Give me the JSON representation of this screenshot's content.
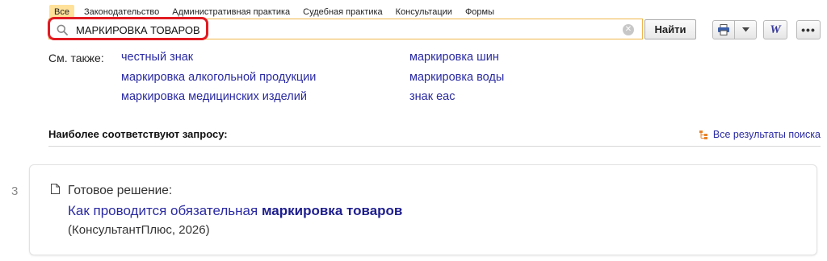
{
  "tabs": [
    "Все",
    "Законодательство",
    "Административная практика",
    "Судебная практика",
    "Консультации",
    "Формы"
  ],
  "search": {
    "value": "МАРКИРОВКА ТОВАРОВ",
    "clear_symbol": "✕",
    "find_label": "Найти"
  },
  "toolbar": {
    "word_label": "W",
    "more_label": "•••"
  },
  "see_also": {
    "label": "См. также:",
    "links": [
      "честный знак",
      "маркировка алкогольной продукции",
      "маркировка медицинских изделий",
      "маркировка шин",
      "маркировка воды",
      "знак еас"
    ]
  },
  "results": {
    "section_title": "Наиболее соответствуют запросу:",
    "all_results_label": "Все результаты поиска",
    "items": [
      {
        "number": "3",
        "kind": "Готовое решение:",
        "title_prefix": "Как проводится обязательная ",
        "title_highlight": "маркировка товаров",
        "source": "(КонсультантПлюс, 2026)"
      }
    ]
  },
  "colors": {
    "accent_tab": "#ffe19a",
    "link": "#2a2aa3",
    "highlight_ring": "#e21b22",
    "search_border": "#f0b64a"
  }
}
